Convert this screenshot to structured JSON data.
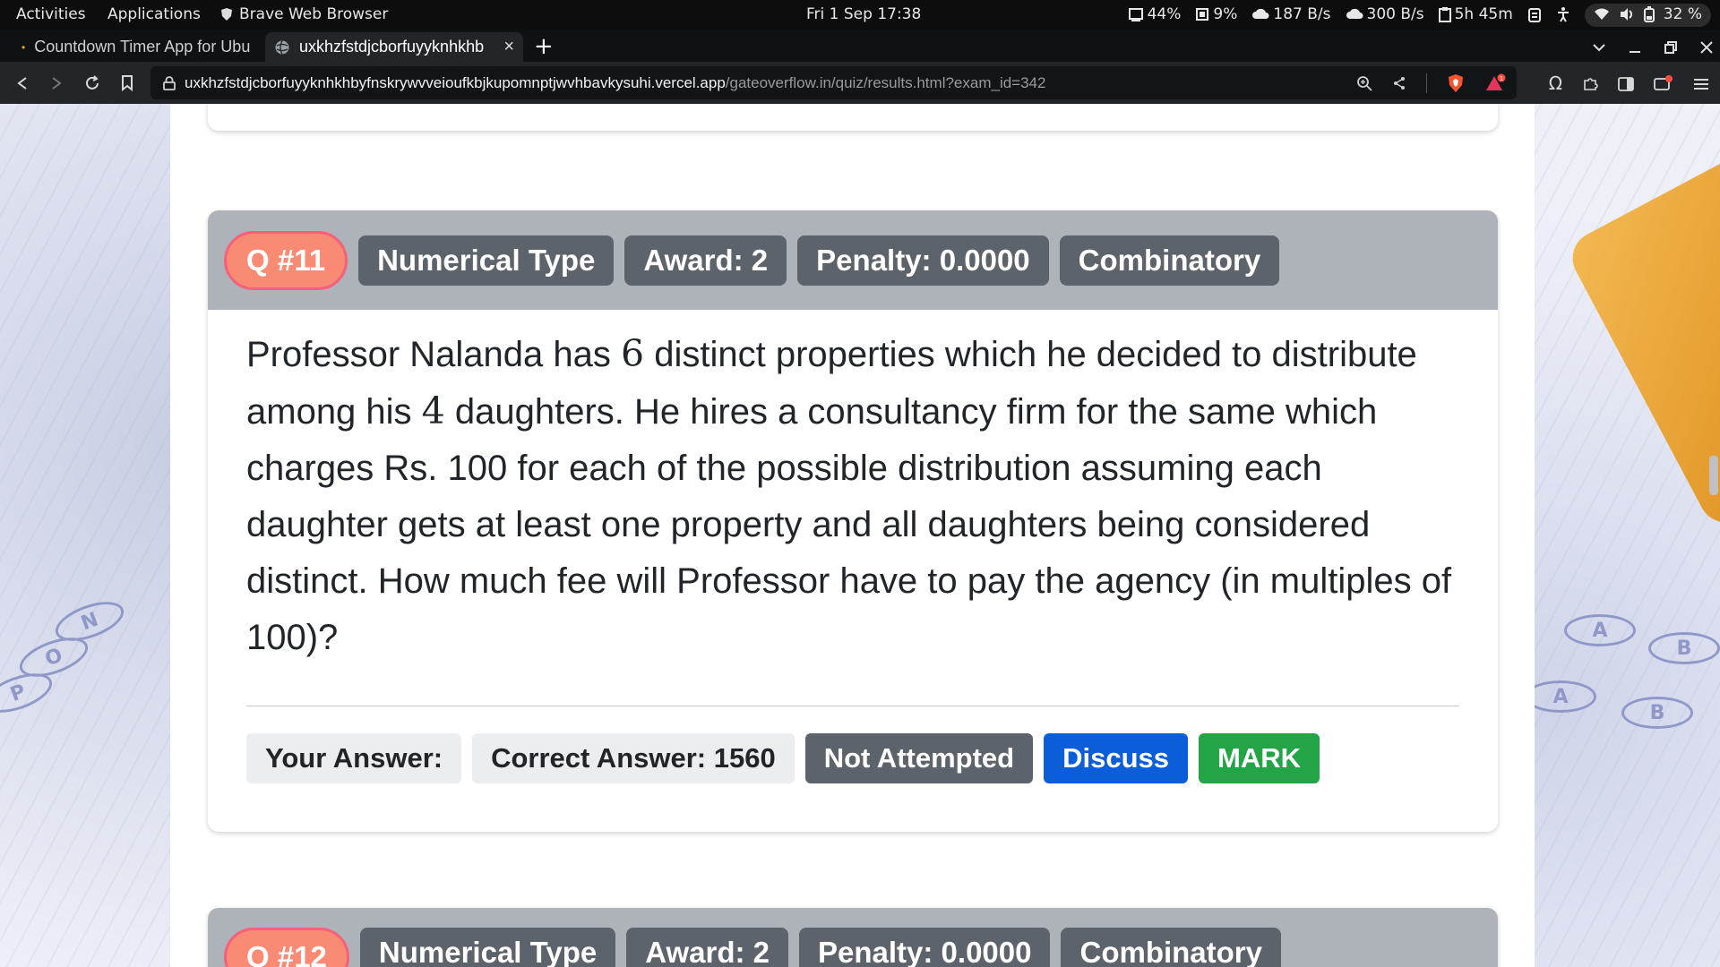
{
  "topbar": {
    "activities": "Activities",
    "applications": "Applications",
    "active_app": "Brave Web Browser",
    "clock": "Fri 1 Sep  17:38",
    "cpu": "44%",
    "mem": "9%",
    "download": "187 B/s",
    "upload": "300 B/s",
    "battery_time": "5h 45m",
    "battery_pct": "32 %"
  },
  "tabs": [
    {
      "label": "Countdown Timer App for Ubu"
    },
    {
      "label": "uxkhzfstdjcborfuyyknhkhb"
    }
  ],
  "new_tab": "+",
  "address": {
    "host": "uxkhzfstdjcborfuyyknhkhbyfnskrywvveioufkbjkupomnptjwvhbavkysuhi.vercel.app",
    "path": "/gateoverflow.in/quiz/results.html?exam_id=342"
  },
  "question11": {
    "number": "Q #11",
    "type": "Numerical Type",
    "award": "Award: 2",
    "penalty": "Penalty: 0.0000",
    "topic": "Combinatory",
    "text_parts": [
      "Professor Nalanda has ",
      "6",
      " distinct properties which he decided to distribute among his ",
      "4",
      " daughters. He hires a consultancy firm for the same which charges Rs. 100 for each of the possible distribution assuming each daughter gets at least one property and all daughters being considered distinct. How much fee will Professor have to pay the agency (in multiples of 100)?"
    ],
    "your_answer": "Your Answer:",
    "correct_answer": "Correct Answer: 1560",
    "status": "Not Attempted",
    "discuss": "Discuss",
    "mark": "MARK"
  },
  "question12": {
    "number": "Q #12",
    "type": "Numerical Type",
    "award": "Award: 2",
    "penalty": "Penalty: 0.0000",
    "topic": "Combinatory"
  },
  "background_bubbles": [
    "A",
    "B",
    "A",
    "B",
    "N",
    "O",
    "P"
  ]
}
